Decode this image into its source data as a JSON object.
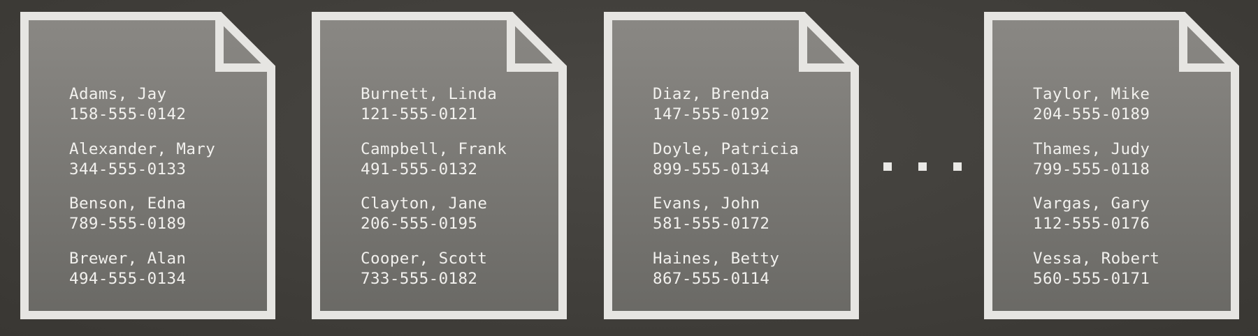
{
  "documents": [
    {
      "records": [
        {
          "name": "Adams, Jay",
          "phone": "158-555-0142"
        },
        {
          "name": "Alexander, Mary",
          "phone": "344-555-0133"
        },
        {
          "name": "Benson, Edna",
          "phone": "789-555-0189"
        },
        {
          "name": "Brewer, Alan",
          "phone": "494-555-0134"
        }
      ]
    },
    {
      "records": [
        {
          "name": "Burnett, Linda",
          "phone": "121-555-0121"
        },
        {
          "name": "Campbell, Frank",
          "phone": "491-555-0132"
        },
        {
          "name": "Clayton, Jane",
          "phone": "206-555-0195"
        },
        {
          "name": "Cooper, Scott",
          "phone": "733-555-0182"
        }
      ]
    },
    {
      "records": [
        {
          "name": "Diaz, Brenda",
          "phone": "147-555-0192"
        },
        {
          "name": "Doyle, Patricia",
          "phone": "899-555-0134"
        },
        {
          "name": "Evans, John",
          "phone": "581-555-0172"
        },
        {
          "name": "Haines, Betty",
          "phone": "867-555-0114"
        }
      ]
    },
    {
      "records": [
        {
          "name": "Taylor, Mike",
          "phone": "204-555-0189"
        },
        {
          "name": "Thames, Judy",
          "phone": "799-555-0118"
        },
        {
          "name": "Vargas, Gary",
          "phone": "112-555-0176"
        },
        {
          "name": "Vessa, Robert",
          "phone": "560-555-0171"
        }
      ]
    }
  ],
  "colors": {
    "background": "#403e3a",
    "page_fill_top": "#8a8884",
    "page_fill_bottom": "#6a6965",
    "page_border": "#e6e5e2",
    "text": "#f2f1ee"
  },
  "separator_icon": "ellipsis-icon"
}
